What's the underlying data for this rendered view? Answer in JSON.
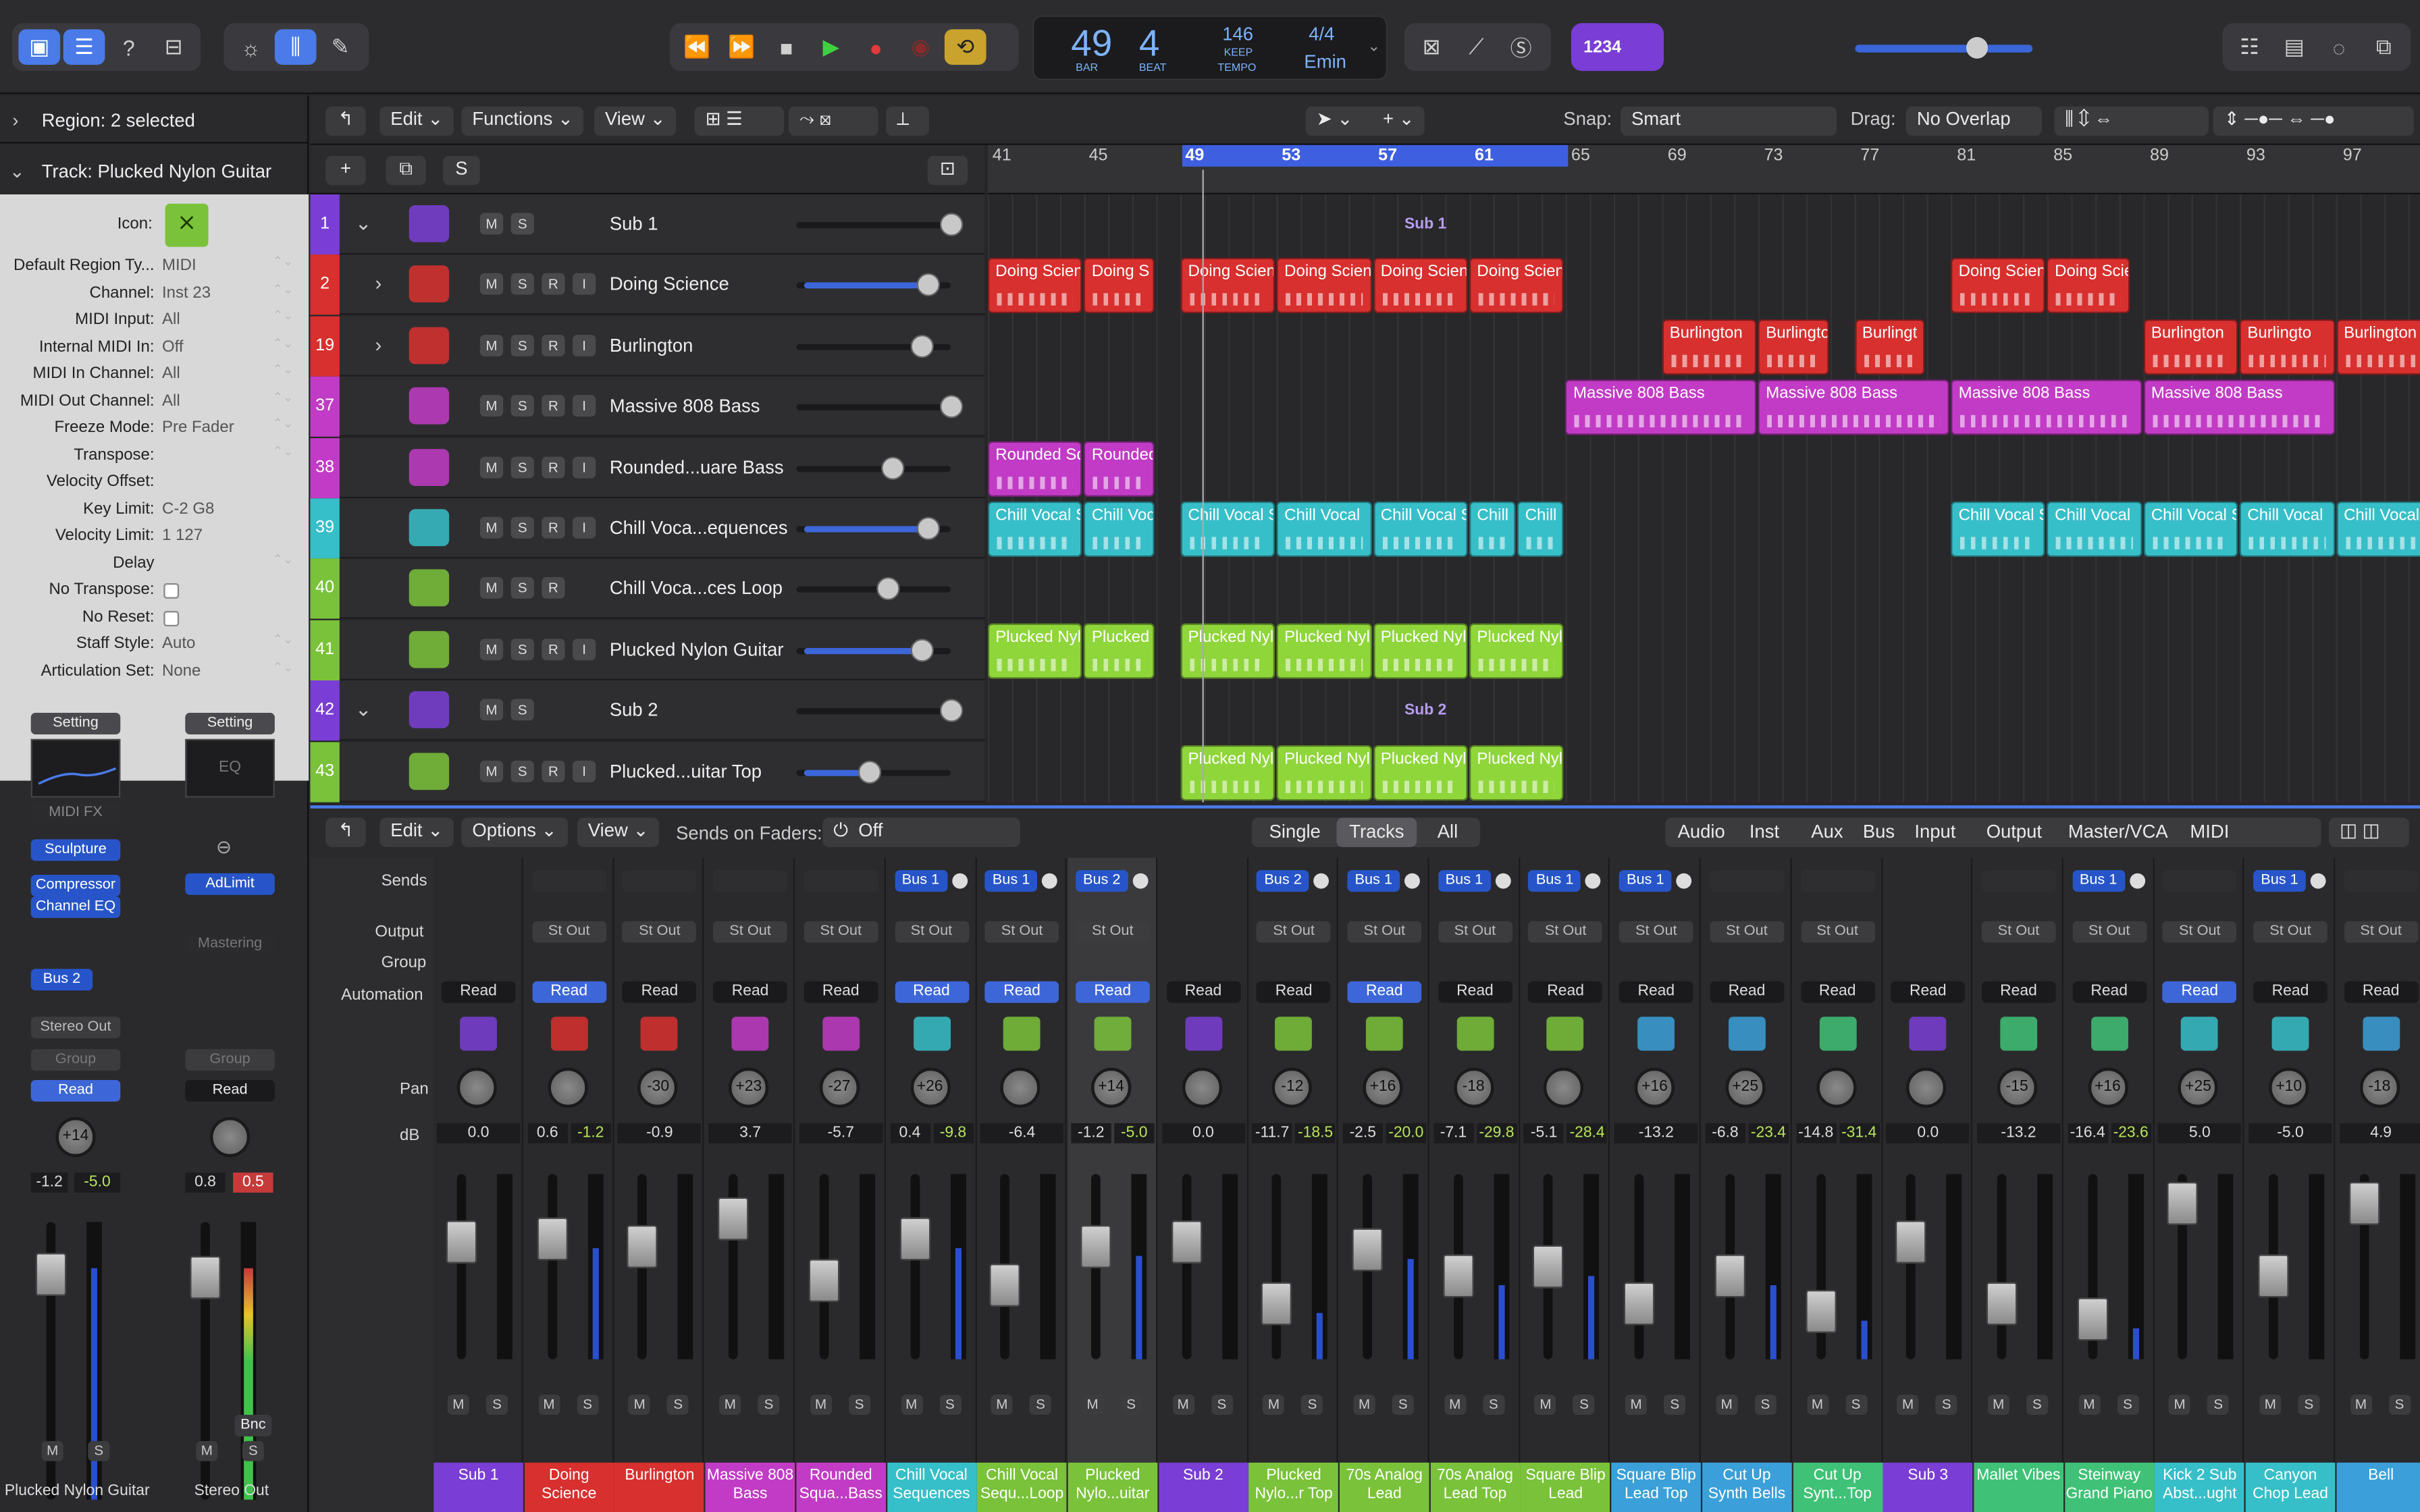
{
  "control": {
    "bar": "49",
    "beat": "4",
    "bar_lbl": "BAR",
    "beat_lbl": "BEAT",
    "tempo": "146",
    "keep": "KEEP",
    "tempo_lbl": "TEMPO",
    "sig": "4/4",
    "key": "Emin",
    "count": "1234"
  },
  "inspector": {
    "region": "Region: 2 selected",
    "track": "Track:  Plucked Nylon Guitar",
    "icon_lbl": "Icon:",
    "rows": [
      {
        "k": "Default Region Ty...",
        "v": "MIDI"
      },
      {
        "k": "Channel:",
        "v": "Inst 23"
      },
      {
        "k": "MIDI Input:",
        "v": "All"
      },
      {
        "k": "Internal MIDI In:",
        "v": "Off"
      },
      {
        "k": "MIDI In Channel:",
        "v": "All"
      },
      {
        "k": "MIDI Out Channel:",
        "v": "All"
      },
      {
        "k": "Freeze Mode:",
        "v": "Pre Fader"
      },
      {
        "k": "Transpose:",
        "v": ""
      },
      {
        "k": "Velocity Offset:",
        "v": ""
      },
      {
        "k": "Key Limit:",
        "v": "C-2  G8"
      },
      {
        "k": "Velocity Limit:",
        "v": "1  127"
      },
      {
        "k": "Delay",
        "v": ""
      },
      {
        "k": "No Transpose:",
        "v": ""
      },
      {
        "k": "No Reset:",
        "v": ""
      },
      {
        "k": "Staff Style:",
        "v": "Auto"
      },
      {
        "k": "Articulation Set:",
        "v": "None"
      }
    ],
    "strip1": {
      "setting": "Setting",
      "midifx": "MIDI FX",
      "plug1": "Sculpture",
      "plug2": "Compressor",
      "plug3": "Channel EQ",
      "send": "Bus 2",
      "out": "Stereo Out",
      "group": "Group",
      "auto": "Read",
      "pan": "+14",
      "db1": "-1.2",
      "db2": "-5.0",
      "m": "M",
      "s": "S",
      "name": "Plucked Nylon Guitar"
    },
    "strip2": {
      "setting": "Setting",
      "eq": "EQ",
      "plug1": "AdLimit",
      "mastering": "Mastering",
      "group": "Group",
      "auto": "Read",
      "db1": "0.8",
      "db2": "0.5",
      "bnc": "Bnc",
      "m": "M",
      "s": "S",
      "name": "Stereo Out"
    }
  },
  "tracks_menu": {
    "edit": "Edit",
    "functions": "Functions",
    "view": "View",
    "snap_lbl": "Snap:",
    "snap": "Smart",
    "drag_lbl": "Drag:",
    "drag": "No Overlap"
  },
  "ruler": [
    "41",
    "45",
    "49",
    "53",
    "57",
    "61",
    "65",
    "69",
    "73",
    "77",
    "81",
    "85",
    "89",
    "93",
    "97"
  ],
  "tracks": [
    {
      "num": "1",
      "name": "Sub 1",
      "color": "#7a3ed6",
      "btns": [
        "M",
        "S"
      ]
    },
    {
      "num": "2",
      "name": "Doing Science",
      "color": "#d8302f",
      "btns": [
        "M",
        "S",
        "R",
        "I"
      ]
    },
    {
      "num": "19",
      "name": "Burlington",
      "color": "#d8302f",
      "btns": [
        "M",
        "S",
        "R",
        "I"
      ]
    },
    {
      "num": "37",
      "name": "Massive 808 Bass",
      "color": "#c23bc6",
      "btns": [
        "M",
        "S",
        "R",
        "I"
      ]
    },
    {
      "num": "38",
      "name": "Rounded...uare Bass",
      "color": "#c23bc6",
      "btns": [
        "M",
        "S",
        "R",
        "I"
      ]
    },
    {
      "num": "39",
      "name": "Chill Voca...equences",
      "color": "#37bfc9",
      "btns": [
        "M",
        "S",
        "R",
        "I"
      ]
    },
    {
      "num": "40",
      "name": "Chill Voca...ces Loop",
      "color": "#7ac23a",
      "btns": [
        "M",
        "S",
        "R"
      ]
    },
    {
      "num": "41",
      "name": "Plucked Nylon Guitar",
      "color": "#7ac23a",
      "btns": [
        "M",
        "S",
        "R",
        "I"
      ]
    },
    {
      "num": "42",
      "name": "Sub 2",
      "color": "#7a3ed6",
      "btns": [
        "M",
        "S"
      ]
    },
    {
      "num": "43",
      "name": "Plucked...uitar Top",
      "color": "#7ac23a",
      "btns": [
        "M",
        "S",
        "R",
        "I"
      ]
    }
  ],
  "regions": {
    "sub1": "Sub 1",
    "sub2": "Sub 2",
    "doing": "Doing Scien",
    "doing_s": "Doing S",
    "doing_scie": "Doing Scie",
    "burl": "Burlington",
    "burlingto": "Burlingto",
    "burlingt": "Burlingt",
    "massive": "Massive 808 Bass",
    "rounded": "Rounded Sq",
    "rounded2": "Rounded",
    "chill": "Chill Vocal S",
    "chill2": "Chill Voc",
    "chill3": "Chill Vocal",
    "chill4": "Chill",
    "pluck": "Plucked Nyl",
    "pluck2": "Plucked"
  },
  "mixer": {
    "edit": "Edit",
    "options": "Options",
    "view": "View",
    "sends_lbl": "Sends on Faders:",
    "sends_val": "Off",
    "single": "Single",
    "tracks": "Tracks",
    "all": "All",
    "types": [
      "Audio",
      "Inst",
      "Aux",
      "Bus",
      "Input",
      "Output",
      "Master/VCA",
      "MIDI"
    ],
    "row_labels": {
      "sends": "Sends",
      "output": "Output",
      "group": "Group",
      "automation": "Automation",
      "pan": "Pan",
      "db": "dB"
    },
    "channels": [
      {
        "name": "Sub 1",
        "color": "#7a3ed6",
        "send": "",
        "out": "",
        "auto": "Read",
        "on": false,
        "pan": "",
        "db1": "0.0",
        "db2": "",
        "cap": 30
      },
      {
        "name": "Doing Science",
        "color": "#d8302f",
        "send": "",
        "out": "St Out",
        "auto": "Read",
        "on": true,
        "pan": "",
        "db1": "0.6",
        "db2": "-1.2",
        "cap": 28
      },
      {
        "name": "Burlington",
        "color": "#d8302f",
        "send": "",
        "out": "St Out",
        "auto": "Read",
        "on": false,
        "pan": "-30",
        "db1": "-0.9",
        "db2": "",
        "cap": 33
      },
      {
        "name": "Massive 808 Bass",
        "color": "#c23bc6",
        "send": "",
        "out": "St Out",
        "auto": "Read",
        "on": false,
        "pan": "+23",
        "db1": "3.7",
        "db2": "",
        "cap": 15
      },
      {
        "name": "Rounded Squa...Bass",
        "color": "#c23bc6",
        "send": "",
        "out": "St Out",
        "auto": "Read",
        "on": false,
        "pan": "-27",
        "db1": "-5.7",
        "db2": "",
        "cap": 55
      },
      {
        "name": "Chill Vocal Sequences",
        "color": "#37bfc9",
        "send": "Bus 1",
        "out": "St Out",
        "auto": "Read",
        "on": true,
        "pan": "+26",
        "db1": "0.4",
        "db2": "-9.8",
        "cap": 28
      },
      {
        "name": "Chill Vocal Sequ...Loop",
        "color": "#7ac23a",
        "send": "Bus 1",
        "out": "St Out",
        "auto": "Read",
        "on": true,
        "pan": "",
        "db1": "-6.4",
        "db2": "",
        "cap": 58
      },
      {
        "name": "Plucked Nylo...uitar",
        "color": "#7ac23a",
        "send": "Bus 2",
        "out": "St Out",
        "auto": "Read",
        "on": true,
        "pan": "+14",
        "db1": "-1.2",
        "db2": "-5.0",
        "cap": 33
      },
      {
        "name": "Sub 2",
        "color": "#7a3ed6",
        "send": "",
        "out": "",
        "auto": "Read",
        "on": false,
        "pan": "",
        "db1": "0.0",
        "db2": "",
        "cap": 30
      },
      {
        "name": "Plucked Nylo...r Top",
        "color": "#7ac23a",
        "send": "Bus 2",
        "out": "St Out",
        "auto": "Read",
        "on": false,
        "pan": "-12",
        "db1": "-11.7",
        "db2": "-18.5",
        "cap": 70
      },
      {
        "name": "70s Analog Lead",
        "color": "#7ac23a",
        "send": "Bus 1",
        "out": "St Out",
        "auto": "Read",
        "on": true,
        "pan": "+16",
        "db1": "-2.5",
        "db2": "-20.0",
        "cap": 35
      },
      {
        "name": "70s Analog Lead Top",
        "color": "#7ac23a",
        "send": "Bus 1",
        "out": "St Out",
        "auto": "Read",
        "on": false,
        "pan": "-18",
        "db1": "-7.1",
        "db2": "-29.8",
        "cap": 52
      },
      {
        "name": "Square Blip Lead",
        "color": "#7ac23a",
        "send": "Bus 1",
        "out": "St Out",
        "auto": "Read",
        "on": false,
        "pan": "",
        "db1": "-5.1",
        "db2": "-28.4",
        "cap": 46
      },
      {
        "name": "Square Blip Lead Top",
        "color": "#3ba0d9",
        "send": "Bus 1",
        "out": "St Out",
        "auto": "Read",
        "on": false,
        "pan": "+16",
        "db1": "-13.2",
        "db2": "",
        "cap": 70
      },
      {
        "name": "Cut Up Synth Bells",
        "color": "#3ba0d9",
        "send": "",
        "out": "St Out",
        "auto": "Read",
        "on": false,
        "pan": "+25",
        "db1": "-6.8",
        "db2": "-23.4",
        "cap": 52
      },
      {
        "name": "Cut Up Synt...Top",
        "color": "#3fc277",
        "send": "",
        "out": "St Out",
        "auto": "Read",
        "on": false,
        "pan": "",
        "db1": "-14.8",
        "db2": "-31.4",
        "cap": 75
      },
      {
        "name": "Sub 3",
        "color": "#7a3ed6",
        "send": "",
        "out": "",
        "auto": "Read",
        "on": false,
        "pan": "",
        "db1": "0.0",
        "db2": "",
        "cap": 30
      },
      {
        "name": "Mallet Vibes",
        "color": "#3fc277",
        "send": "",
        "out": "St Out",
        "auto": "Read",
        "on": false,
        "pan": "-15",
        "db1": "-13.2",
        "db2": "",
        "cap": 70
      },
      {
        "name": "Steinway Grand Piano",
        "color": "#3fc277",
        "send": "Bus 1",
        "out": "St Out",
        "auto": "Read",
        "on": false,
        "pan": "+16",
        "db1": "-16.4",
        "db2": "-23.6",
        "cap": 80
      },
      {
        "name": "Kick 2 Sub Abst...ught",
        "color": "#37bfc9",
        "send": "",
        "out": "St Out",
        "auto": "Read",
        "on": true,
        "pan": "+25",
        "db1": "5.0",
        "db2": "",
        "cap": 5
      },
      {
        "name": "Canyon Chop Lead",
        "color": "#37bfc9",
        "send": "Bus 1",
        "out": "St Out",
        "auto": "Read",
        "on": false,
        "pan": "+10",
        "db1": "-5.0",
        "db2": "",
        "cap": 52
      },
      {
        "name": "Bell",
        "color": "#3ba0d9",
        "send": "",
        "out": "St Out",
        "auto": "Read",
        "on": false,
        "pan": "-18",
        "db1": "4.9",
        "db2": "",
        "cap": 5
      }
    ]
  }
}
